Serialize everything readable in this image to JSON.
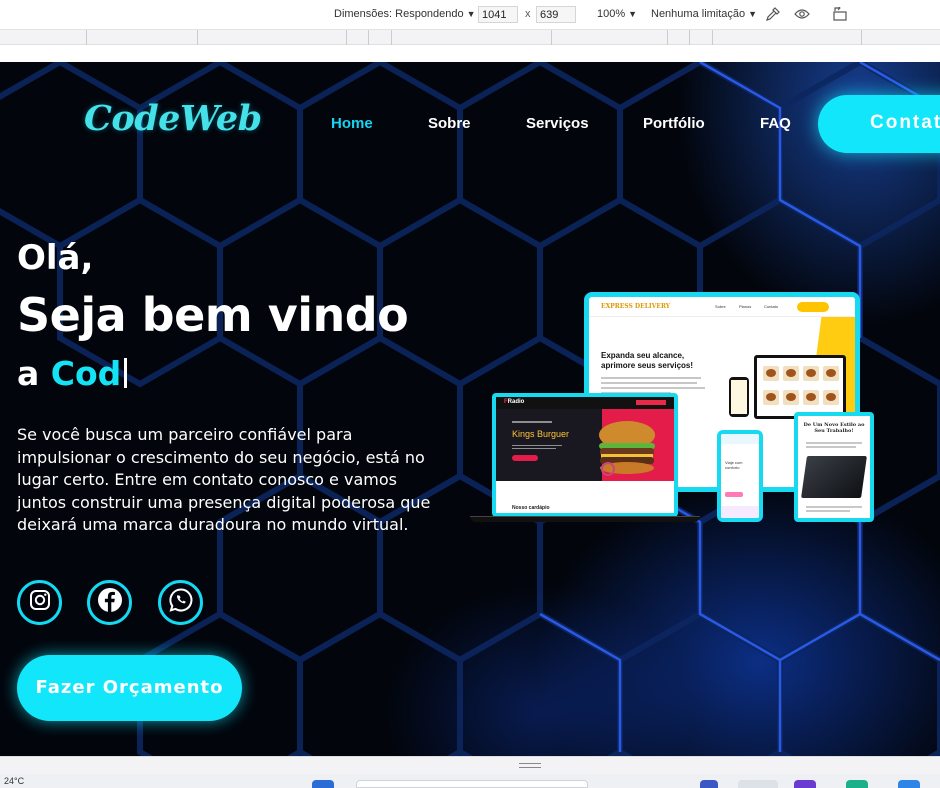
{
  "devtools": {
    "dimensions_label": "Dimensões: Respondendo",
    "width_value": "1041",
    "times": "x",
    "height_value": "639",
    "zoom": "100%",
    "throttle": "Nenhuma limitação",
    "icons": [
      "eyedropper-icon",
      "eye-icon",
      "rotate-icon"
    ]
  },
  "site": {
    "logo": "CodeWeb",
    "nav": [
      {
        "label": "Home",
        "active": true
      },
      {
        "label": "Sobre"
      },
      {
        "label": "Serviços"
      },
      {
        "label": "Portfólio"
      },
      {
        "label": "FAQ"
      }
    ],
    "contact_button": "Contato",
    "hero": {
      "greeting": "Olá,",
      "headline": "Seja bem vindo",
      "typed_prefix": "a ",
      "typed_accent": "Cod",
      "paragraph": "Se você busca um parceiro confiável para impulsionar o crescimento do seu negócio, está no lugar certo. Entre em contato conosco e vamos juntos construir uma presença digital poderosa que deixará uma marca duradoura no mundo virtual."
    },
    "social": [
      "instagram-icon",
      "facebook-icon",
      "whatsapp-icon"
    ],
    "cta": "Fazer Orçamento",
    "accent_color": "#12e6fb",
    "mockups": {
      "monitor_brand": "EXPRESS DELIVERY",
      "monitor_links": [
        "Sobre",
        "Planos",
        "Contato"
      ],
      "monitor_heading": "Expanda seu alcance, aprimore seus serviços!",
      "laptop_logo_a": "F",
      "laptop_logo_b": "Radio",
      "laptop_title": "Kings Burguer",
      "laptop_footer": "Nosso cardápio",
      "phone_text": "Viaje com conforto",
      "tablet_title": "De Um Novo Estilo ao Seu Trabalho!"
    }
  },
  "taskbar": {
    "temperature": "24°C"
  }
}
